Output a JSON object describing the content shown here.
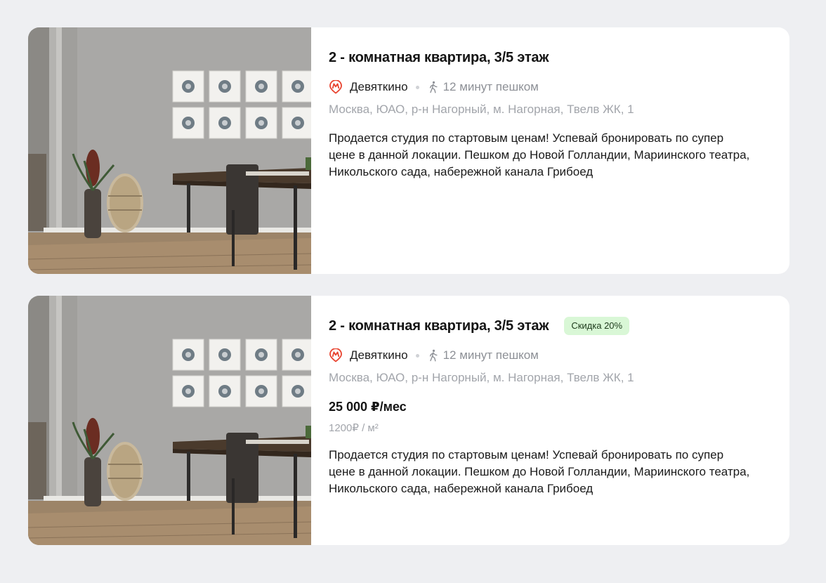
{
  "colors": {
    "background": "#eeeff2",
    "card": "#ffffff",
    "metro_red": "#e8432f",
    "badge_bg": "#d9f7d6",
    "muted_text": "#a2a5ab"
  },
  "listings": [
    {
      "title": "2 - комнатная квартира, 3/5 этаж",
      "metro_icon": "metro-icon",
      "station": "Девяткино",
      "walk_icon": "walking-person-icon",
      "walk_time": "12 минут пешком",
      "address": "Москва, ЮАО, р-н Нагорный, м. Нагорная, Твелв ЖК, 1",
      "description": "Продается студия по стартовым ценам! Успевай бронировать по супер цене в данной локации. Пешком до Новой Голландии, Мариинского театра, Никольского сада, набережной канала Грибоед"
    },
    {
      "title": "2 - комнатная квартира, 3/5 этаж",
      "badge": "Скидка 20%",
      "metro_icon": "metro-icon",
      "station": "Девяткино",
      "walk_icon": "walking-person-icon",
      "walk_time": "12 минут пешком",
      "address": "Москва, ЮАО, р-н Нагорный, м. Нагорная, Твелв ЖК, 1",
      "price": "25 000 ₽/мес",
      "price_per_sqm": "1200₽ / м²",
      "description": "Продается студия по стартовым ценам! Успевай бронировать по супер цене в данной локации. Пешком до Новой Голландии, Мариинского театра, Никольского сада, набережной канала Грибоед"
    }
  ]
}
